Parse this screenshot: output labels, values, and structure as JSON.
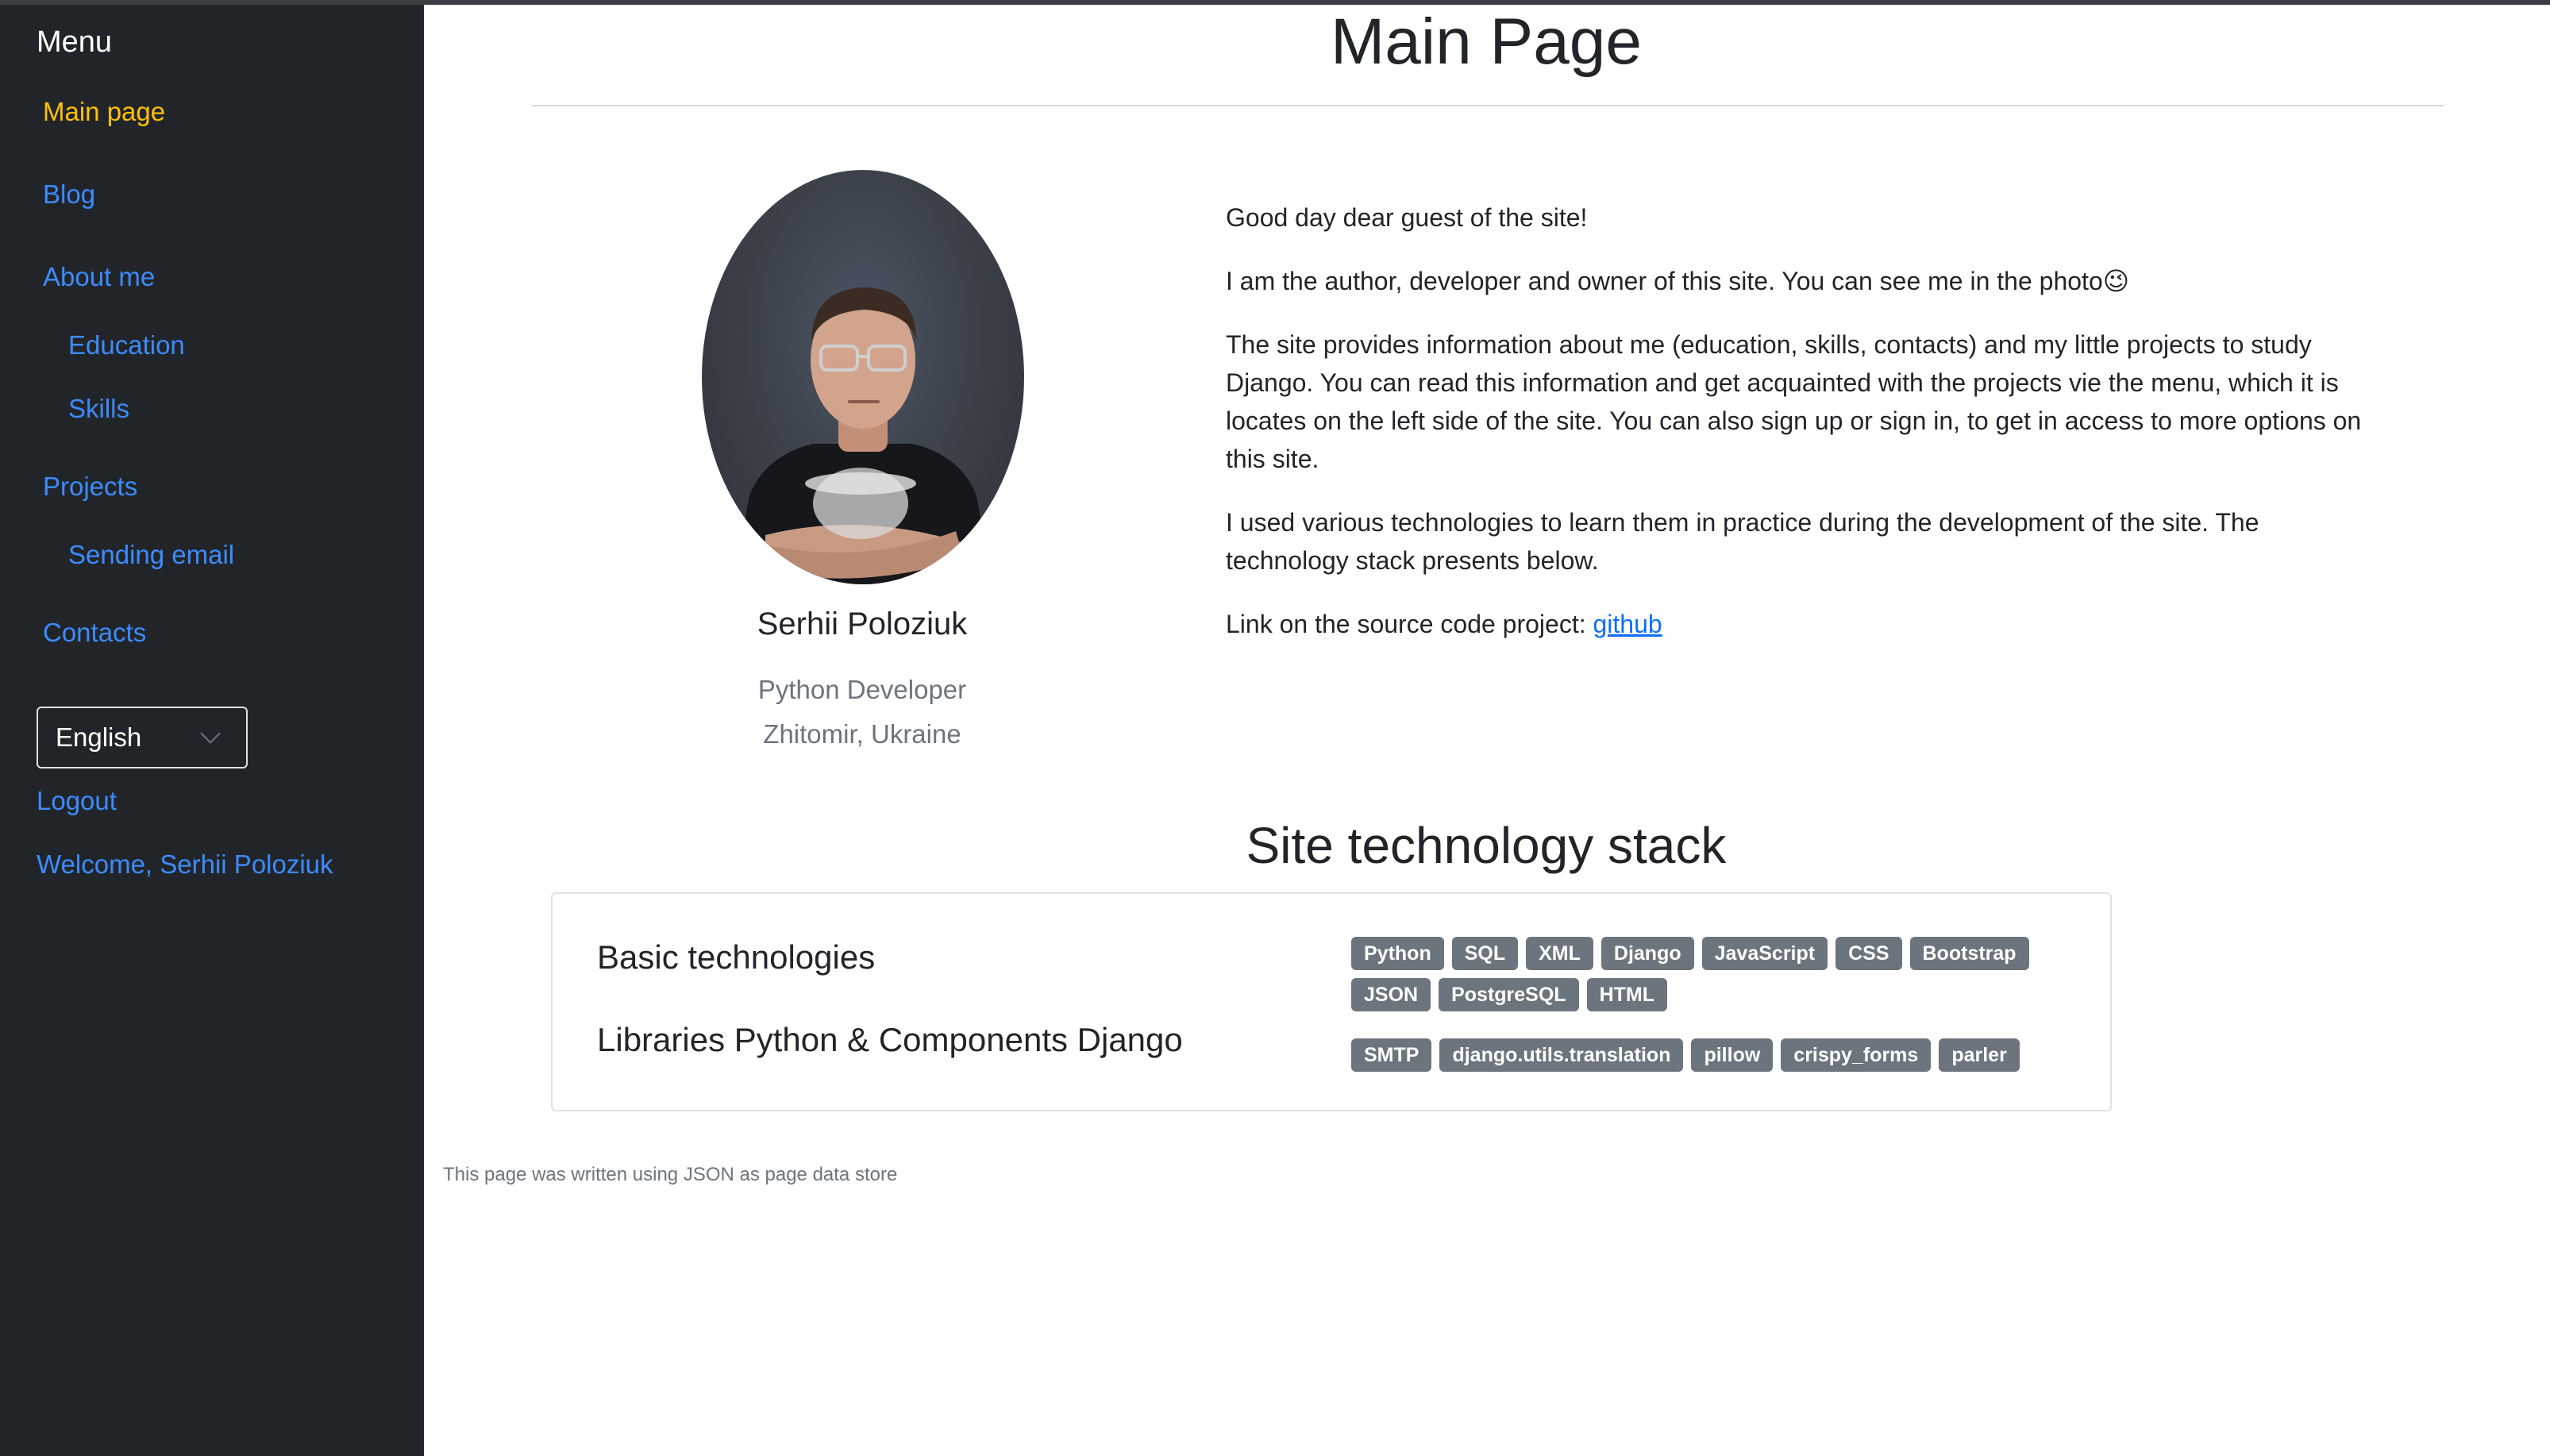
{
  "sidebar": {
    "menu_title": "Menu",
    "items": [
      {
        "label": "Main page"
      },
      {
        "label": "Blog"
      },
      {
        "label": "About me"
      },
      {
        "label": "Education"
      },
      {
        "label": "Skills"
      },
      {
        "label": "Projects"
      },
      {
        "label": "Sending email"
      },
      {
        "label": "Contacts"
      }
    ],
    "language_selected": "English",
    "logout_label": "Logout",
    "welcome_text": "Welcome, Serhii Poloziuk"
  },
  "main": {
    "title": "Main Page",
    "profile": {
      "name": "Serhii Poloziuk",
      "role": "Python Developer",
      "location": "Zhitomir, Ukraine"
    },
    "intro": {
      "p1": "Good day dear guest of the site!",
      "p2": "I am the author, developer and owner of this site. You can see me in the photo😉",
      "p3": "The site provides information about me (education, skills, contacts) and my little projects to study Django. You can read this information and get acquainted with the projects vie the menu, which it is locates on the left side of the site. You can also sign up or sign in, to get in access to more options on this site.",
      "p4": "I used various technologies to learn them in practice during the development of the site. The technology stack presents below.",
      "p5_prefix": "Link on the source code project: ",
      "p5_link": "github"
    },
    "stack": {
      "title": "Site technology stack",
      "rows": [
        {
          "label": "Basic technologies",
          "badges": [
            "Python",
            "SQL",
            "XML",
            "Django",
            "JavaScript",
            "CSS",
            "Bootstrap",
            "JSON",
            "PostgreSQL",
            "HTML"
          ]
        },
        {
          "label": "Libraries Python & Components Django",
          "badges": [
            "SMTP",
            "django.utils.translation",
            "pillow",
            "crispy_forms",
            "parler"
          ]
        }
      ]
    },
    "footer_note": "This page was written using JSON as page data store"
  },
  "colors": {
    "sidebar_bg": "#212529",
    "link": "#3d8bfd",
    "active_link": "#ffc107",
    "badge_bg": "#6c757d"
  }
}
